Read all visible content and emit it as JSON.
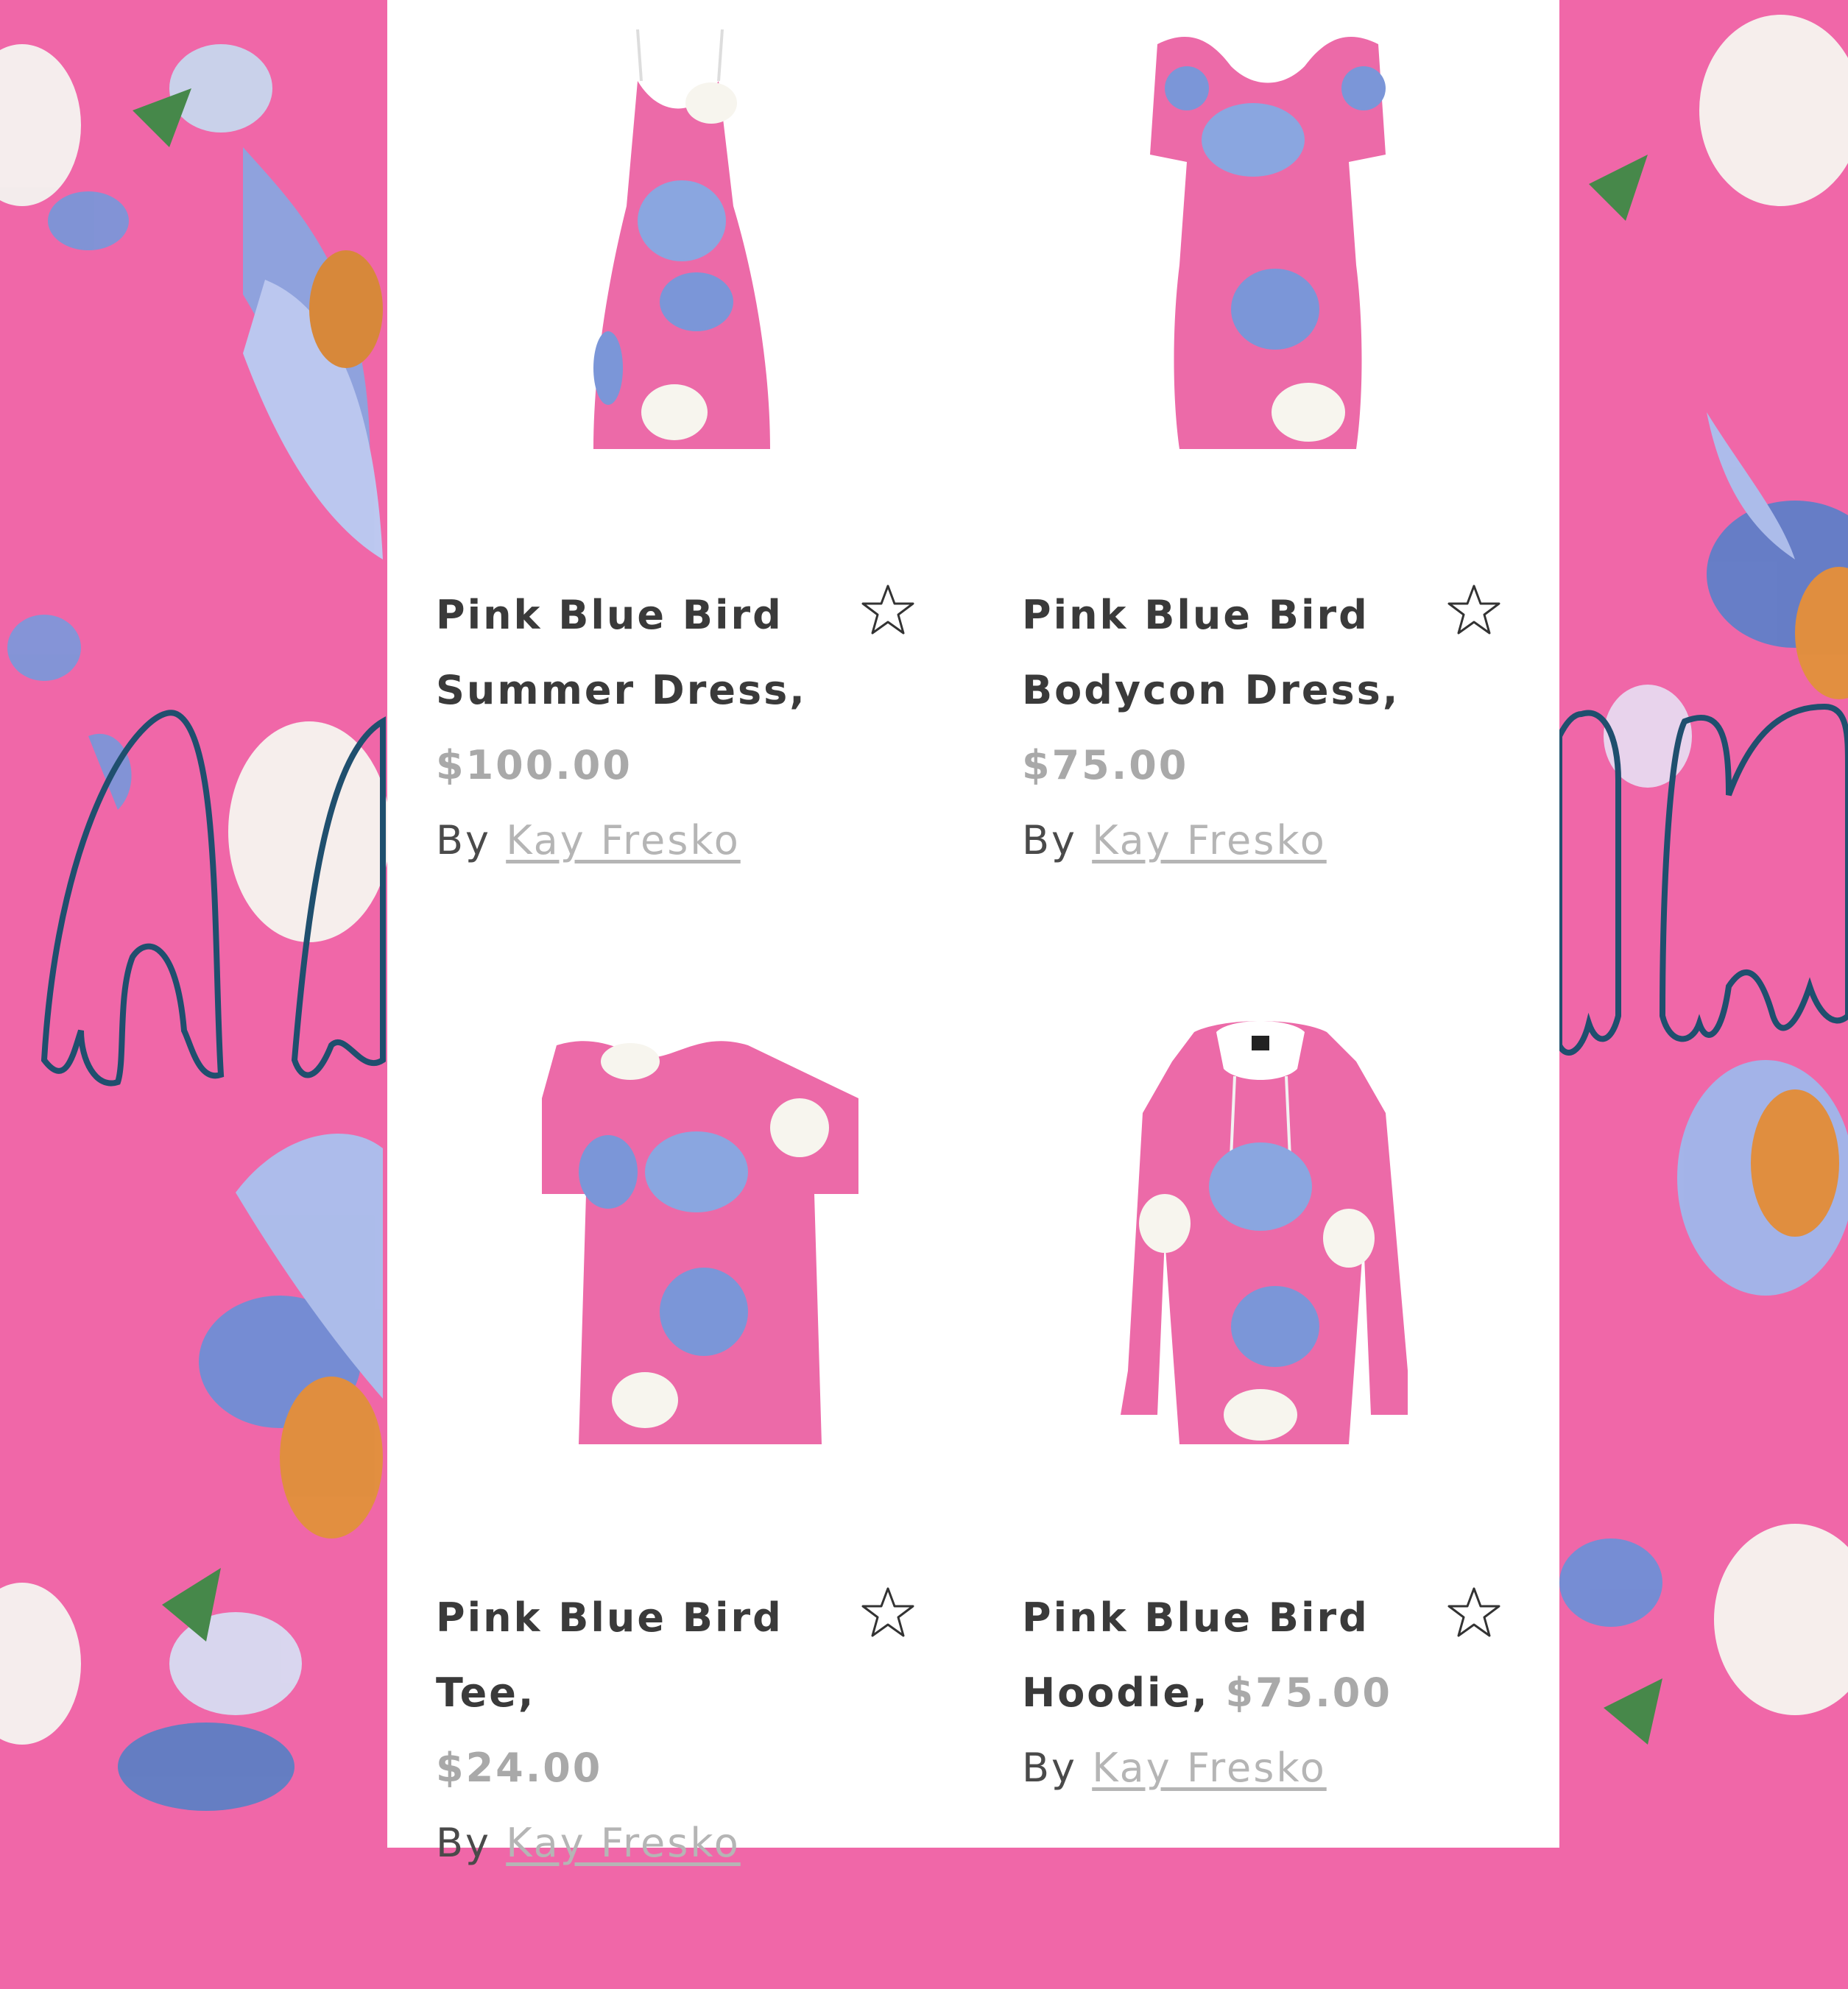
{
  "colors": {
    "background_pink": "#f067a8",
    "panel": "#ffffff",
    "title": "#3a3a3a",
    "price": "#a9a9a9",
    "author_link": "#b5b5b5",
    "drip_outline": "#1f4f6e"
  },
  "products": [
    {
      "name": "Pink Blue Bird Summer Dress,",
      "price": "$100.00",
      "by_label": "By",
      "author": "Kay Fresko",
      "icon": "star-icon",
      "image": "summer-dress"
    },
    {
      "name": "Pink Blue Bird Bodycon Dress,",
      "price": "$75.00",
      "by_label": "By",
      "author": "Kay Fresko",
      "icon": "star-icon",
      "image": "bodycon-dress"
    },
    {
      "name": "Pink Blue Bird Tee,",
      "price": "$24.00",
      "by_label": "By",
      "author": "Kay Fresko",
      "icon": "star-icon",
      "image": "tee"
    },
    {
      "name": "Pink Blue Bird Hoodie,",
      "price": "$75.00",
      "by_label": "By",
      "author": "Kay Fresko",
      "icon": "star-icon",
      "image": "hoodie"
    }
  ]
}
